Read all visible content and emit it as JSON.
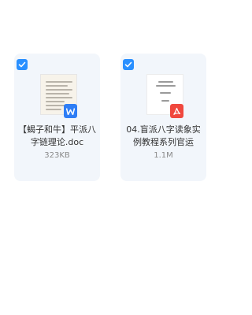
{
  "files": [
    {
      "name": "【蝎子和牛】平派八字链理论.doc",
      "size": "323KB",
      "type_icon": "word-icon",
      "selected": true
    },
    {
      "name": "04.盲派八字读象实例教程系列官运",
      "size": "1.1M",
      "type_icon": "pdf-icon",
      "selected": true
    }
  ],
  "colors": {
    "accent": "#2a90ff",
    "card_bg": "#f2f6fb",
    "word": "#2f7ef5",
    "pdf": "#f0483e"
  }
}
